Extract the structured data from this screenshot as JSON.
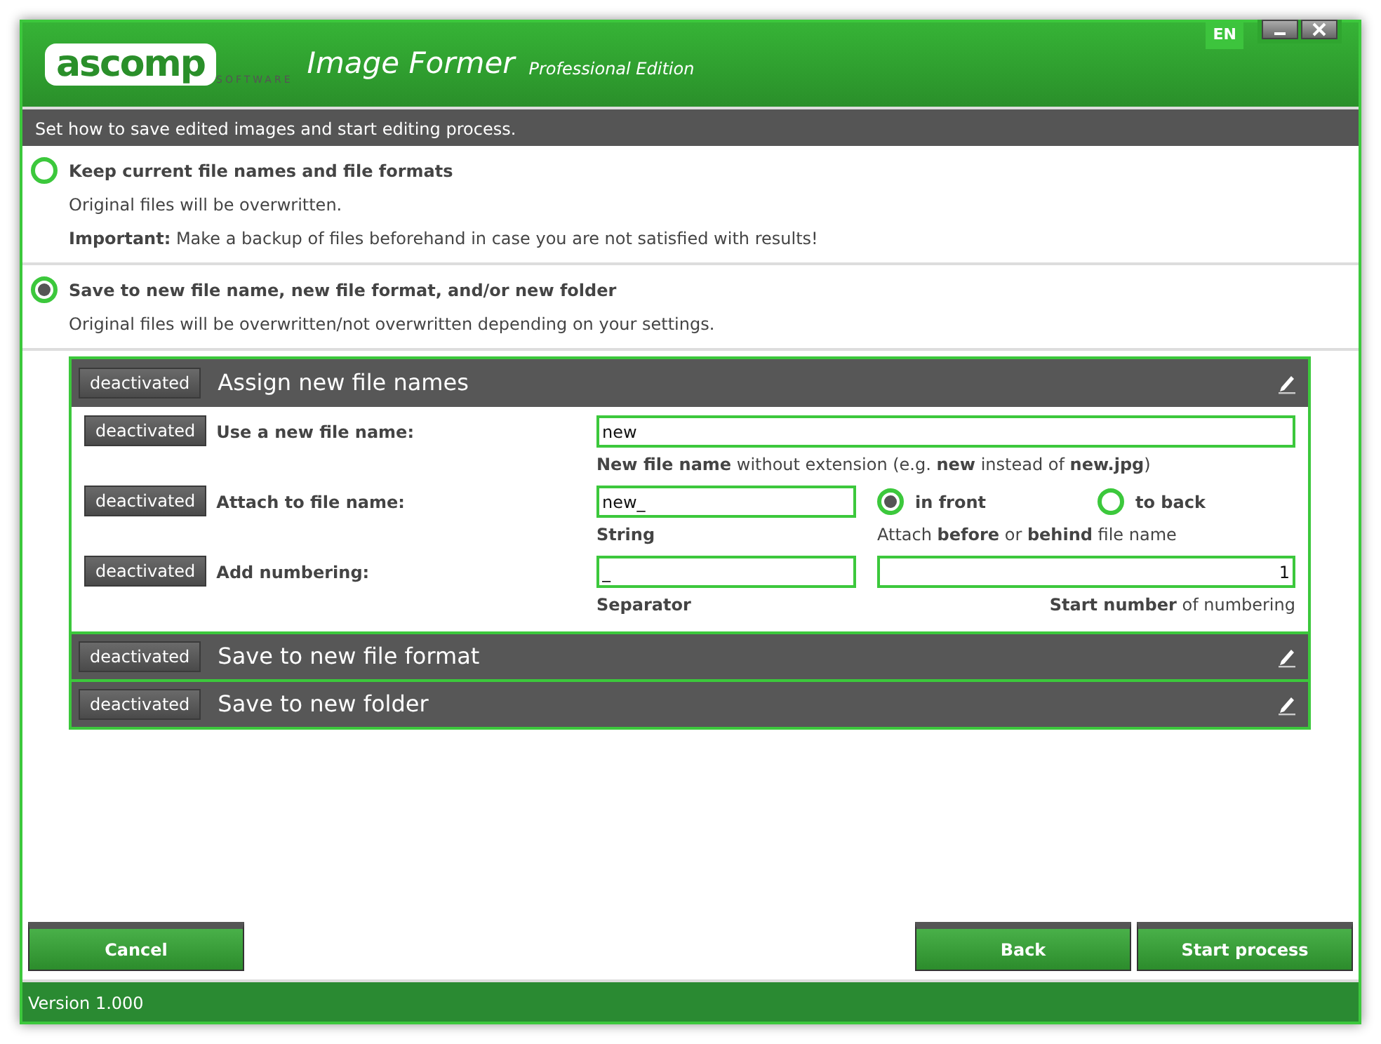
{
  "header": {
    "logo": "ascomp",
    "logo_sub": "SOFTWARE",
    "title": "Image Former",
    "edition": "Professional Edition",
    "language": "EN"
  },
  "instruction": "Set how to save edited images and start editing process.",
  "options": [
    {
      "label": "Keep current file names and file formats",
      "lines": [
        "Original files will be overwritten.",
        "**Important:** Make a backup of files beforehand in case you are not satisfied with results!"
      ],
      "selected": false
    },
    {
      "label": "Save to new file name, new file format, and/or new folder",
      "lines": [
        "Original files will be overwritten/not overwritten depending on your settings."
      ],
      "selected": true
    }
  ],
  "sections": [
    {
      "toggle": "deactivated",
      "title": "Assign new file names",
      "expanded": true,
      "rows": [
        {
          "kind": "text",
          "toggle": "deactivated",
          "label": "Use a new file name:",
          "value": "new",
          "hint": "**New file name** without extension (e.g. **new** instead of **new.jpg**)"
        },
        {
          "kind": "attach",
          "toggle": "deactivated",
          "label": "Attach to file name:",
          "value": "new_",
          "hint": "String",
          "radios": [
            {
              "label": "in front",
              "selected": true
            },
            {
              "label": "to back",
              "selected": false
            }
          ],
          "radio_hint": "Attach **before** or **behind** file name"
        },
        {
          "kind": "numbering",
          "toggle": "deactivated",
          "label": "Add numbering:",
          "value": "_",
          "hint": "Separator",
          "number": "1",
          "number_hint": "**Start number** of numbering"
        }
      ]
    },
    {
      "toggle": "deactivated",
      "title": "Save to new file format",
      "expanded": false
    },
    {
      "toggle": "deactivated",
      "title": "Save to new folder",
      "expanded": false
    }
  ],
  "buttons_left": [
    "Cancel"
  ],
  "buttons_right": [
    "Back",
    "Start process"
  ],
  "status_bar": "Version 1.000"
}
